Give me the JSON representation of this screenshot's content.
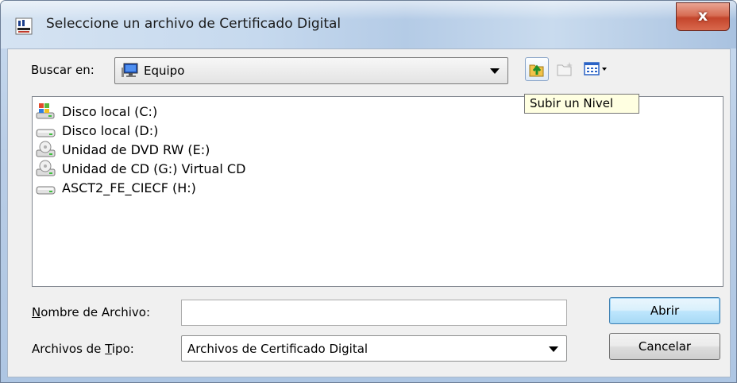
{
  "window": {
    "title": "Seleccione un archivo de Certificado Digital",
    "close_glyph": "x",
    "icon": "java-app-icon"
  },
  "look_in": {
    "label": "Buscar en:",
    "value": "Equipo",
    "value_icon": "computer-icon"
  },
  "toolbar": {
    "up_icon": "up-one-level-icon",
    "new_folder_icon": "new-folder-icon",
    "view_menu_icon": "view-menu-icon",
    "tooltip": "Subir un Nivel"
  },
  "files": [
    {
      "name": "Disco local (C:)",
      "icon": "system-drive-icon"
    },
    {
      "name": "Disco local (D:)",
      "icon": "hard-drive-icon"
    },
    {
      "name": "Unidad de DVD RW (E:)",
      "icon": "optical-drive-icon"
    },
    {
      "name": "Unidad de CD (G:) Virtual CD",
      "icon": "optical-drive-icon"
    },
    {
      "name": "ASCT2_FE_CIECF (H:)",
      "icon": "hard-drive-icon"
    }
  ],
  "file_name": {
    "label_pre": "",
    "label_key": "N",
    "label_rest": "ombre de Archivo:",
    "value": ""
  },
  "file_type": {
    "label_pre": "Archivos de ",
    "label_key": "T",
    "label_rest": "ipo:",
    "value": "Archivos de Certificado Digital"
  },
  "buttons": {
    "open": "Abrir",
    "cancel": "Cancelar"
  }
}
